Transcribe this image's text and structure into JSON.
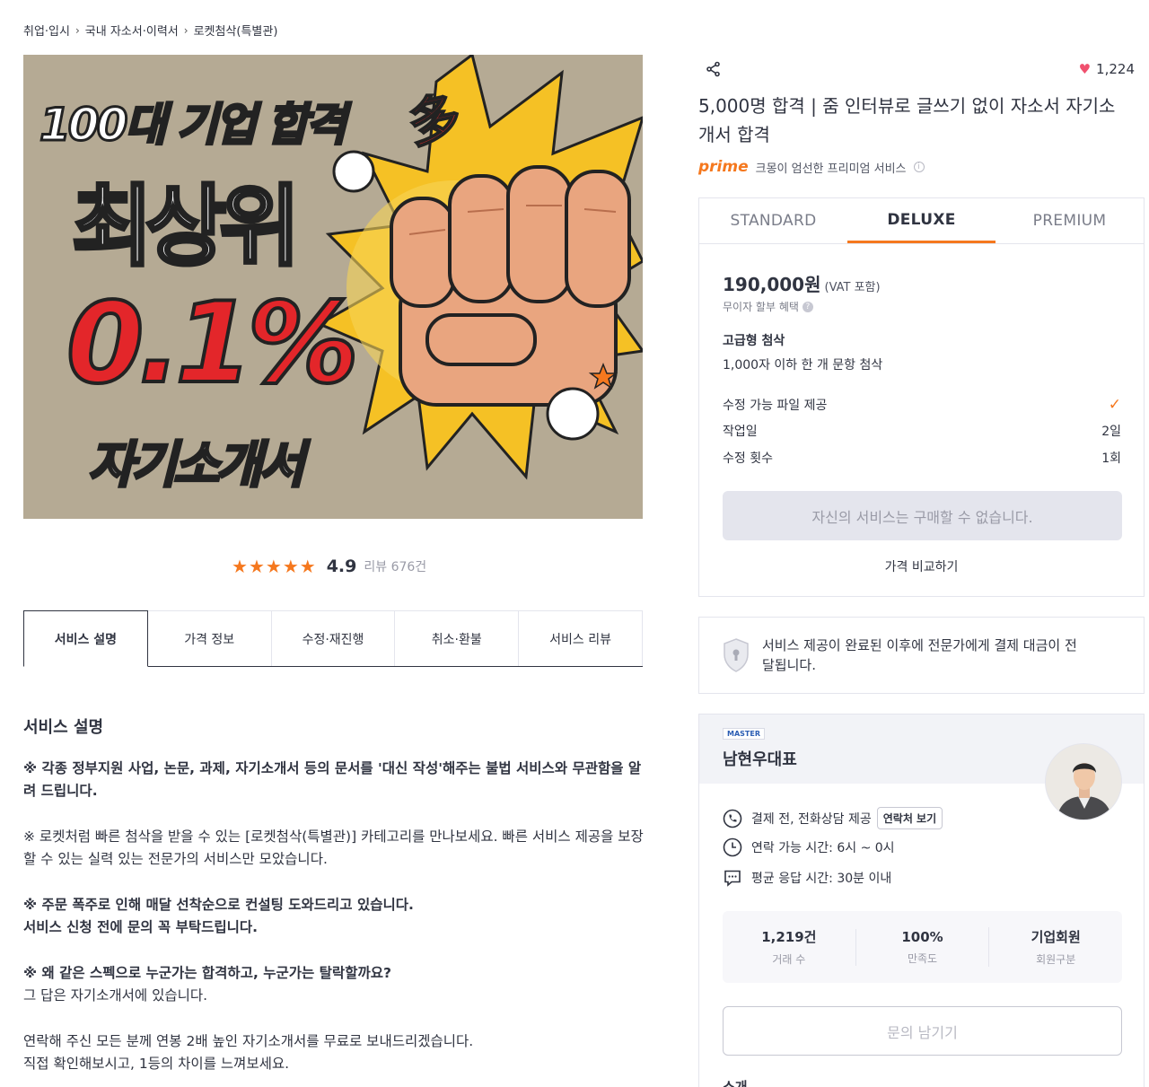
{
  "breadcrumb": [
    "취업·입시",
    "국내 자소서·이력서",
    "로켓첨삭(특별관)"
  ],
  "hero": {
    "line1": "100대 기업 합격",
    "many": "多",
    "line2": "최상위",
    "line3": "0.1%",
    "line4": "자기소개서"
  },
  "rating": {
    "stars": 5,
    "score": "4.9",
    "reviews": "리뷰 676건"
  },
  "tabs": [
    "서비스 설명",
    "가격 정보",
    "수정·재진행",
    "취소·환불",
    "서비스 리뷰"
  ],
  "description": {
    "heading": "서비스 설명",
    "p1": "※ 각종 정부지원 사업, 논문, 과제, 자기소개서 등의 문서를 '대신 작성'해주는 불법 서비스와 무관함을 알려 드립니다.",
    "p2": "※ 로켓처럼 빠른 첨삭을 받을 수 있는 [로켓첨삭(특별관)] 카테고리를 만나보세요. 빠른 서비스 제공을 보장할 수 있는 실력 있는 전문가의 서비스만 모았습니다.",
    "p3a": "※ 주문 폭주로 인해 매달 선착순으로 컨설팅 도와드리고 있습니다.",
    "p3b": "서비스 신청 전에 문의 꼭 부탁드립니다.",
    "p4a": "※ 왜 같은 스펙으로 누군가는 합격하고, 누군가는 탈락할까요?",
    "p4b": "그 답은 자기소개서에 있습니다.",
    "p5a": "연락해 주신 모든 분께 연봉 2배 높인 자기소개서를 무료로 보내드리겠습니다.",
    "p5b": "직접 확인해보시고, 1등의 차이를 느껴보세요."
  },
  "likes": "1,224",
  "title": "5,000명 합격 | 줌 인터뷰로 글쓰기 없이 자소서 자기소개서 합격",
  "prime": {
    "logo": "prime",
    "text": "크몽이 엄선한 프리미엄 서비스",
    "info": "i"
  },
  "package": {
    "tabs": [
      "STANDARD",
      "DELUXE",
      "PREMIUM"
    ],
    "active": 1,
    "price": "190,000원",
    "vat": "(VAT 포함)",
    "installment": "무이자 할부 혜택",
    "q": "?",
    "name": "고급형 첨삭",
    "detail": "1,000자 이하 한 개 문항 첨삭",
    "options": [
      {
        "label": "수정 가능 파일 제공",
        "value": "✓"
      },
      {
        "label": "작업일",
        "value": "2일"
      },
      {
        "label": "수정 횟수",
        "value": "1회"
      }
    ],
    "buy": "자신의 서비스는 구매할 수 없습니다.",
    "compare": "가격 비교하기"
  },
  "notice": "서비스 제공이 완료된 이후에 전문가에게 결제 대금이 전달됩니다.",
  "seller": {
    "badge": "MASTER",
    "name": "남현우대표",
    "rows": [
      {
        "text": "결제 전, 전화상담 제공",
        "button": "연락처 보기"
      },
      {
        "text": "연락 가능 시간: 6시 ~ 0시"
      },
      {
        "text": "평균 응답 시간: 30분 이내"
      }
    ],
    "stats": [
      {
        "value": "1,219건",
        "label": "거래 수"
      },
      {
        "value": "100%",
        "label": "만족도"
      },
      {
        "value": "기업회원",
        "label": "회원구분"
      }
    ],
    "inquiry": "문의 남기기",
    "intro": "소개"
  },
  "colors": {
    "accent": "#f5781e",
    "heart": "#f0506e",
    "text": "#303441"
  }
}
